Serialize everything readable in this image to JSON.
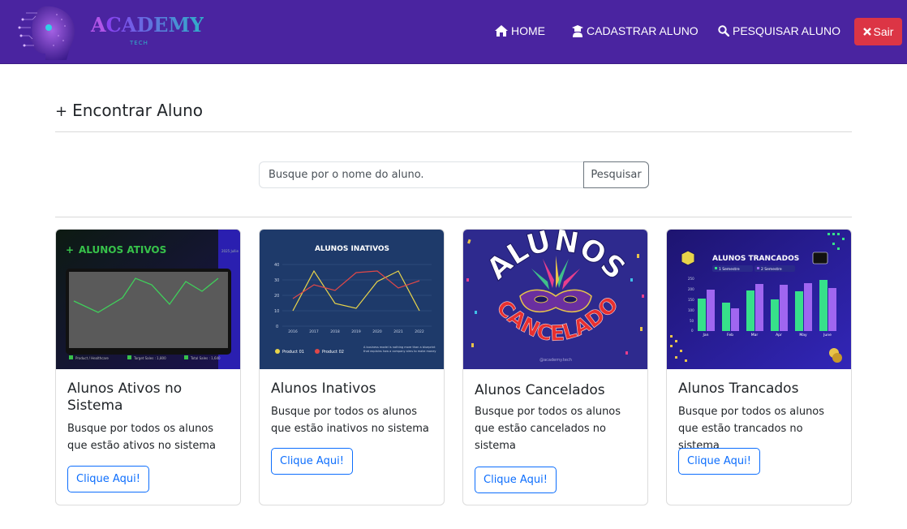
{
  "brand": {
    "name_first": "A",
    "name_rest": "CADEMY",
    "tagline": "TECH"
  },
  "nav": {
    "home": "HOME",
    "cadastrar": "CADASTRAR ALUNO",
    "pesquisar": "PESQUISAR ALUNO",
    "sair": "Sair"
  },
  "page": {
    "title": "Encontrar Aluno",
    "search_placeholder": "Busque por o nome do aluno.",
    "search_button": "Pesquisar"
  },
  "cards": [
    {
      "title": "Alunos Ativos no Sistema",
      "text": "Busque por todos os alunos que estão ativos no sistema",
      "button": "Clique Aqui!",
      "image": {
        "heading": "ALUNOS ATIVOS",
        "corner": "2025 Jullie",
        "legend": [
          "Product / Healthcare",
          "Target Sales : 1,800",
          "Total Sales : 1,640"
        ]
      }
    },
    {
      "title": "Alunos Inativos",
      "text": "Busque por todos os alunos que estão inativos no sistema",
      "button": "Clique Aqui!",
      "image": {
        "heading": "ALUNOS INATIVOS",
        "y_ticks": [
          "40",
          "30",
          "20",
          "10",
          "0"
        ],
        "x_ticks": [
          "2016",
          "2017",
          "2018",
          "2019",
          "2020",
          "2021",
          "2022"
        ],
        "legend": [
          "Product 01",
          "Product 02"
        ],
        "note": "A business model is nothing more than a blueprint that explains how a company aims to make money"
      }
    },
    {
      "title": "Alunos Cancelados",
      "text": "Busque por todos os alunos que estão cancelados no sistema",
      "button": "Clique Aqui!",
      "image": {
        "top": "ALUNOS",
        "bottom": "CANCELADO",
        "handle": "@academy.tech"
      }
    },
    {
      "title": "Alunos Trancados",
      "text": "Busque por todos os alunos que estão trancados no sistema",
      "button": "Clique Aqui!",
      "image": {
        "heading": "ALUNOS TRANCADOS",
        "legend": [
          "1 Semestre",
          "2 Semestre"
        ],
        "y_ticks": [
          "250",
          "200",
          "150",
          "100",
          "50",
          "0"
        ],
        "x_ticks": [
          "Jan",
          "Feb",
          "Mar",
          "Apr",
          "May",
          "June"
        ]
      }
    }
  ],
  "colors": {
    "navbar": "#4a24a0",
    "danger": "#dc3545",
    "primary": "#0d6efd"
  }
}
